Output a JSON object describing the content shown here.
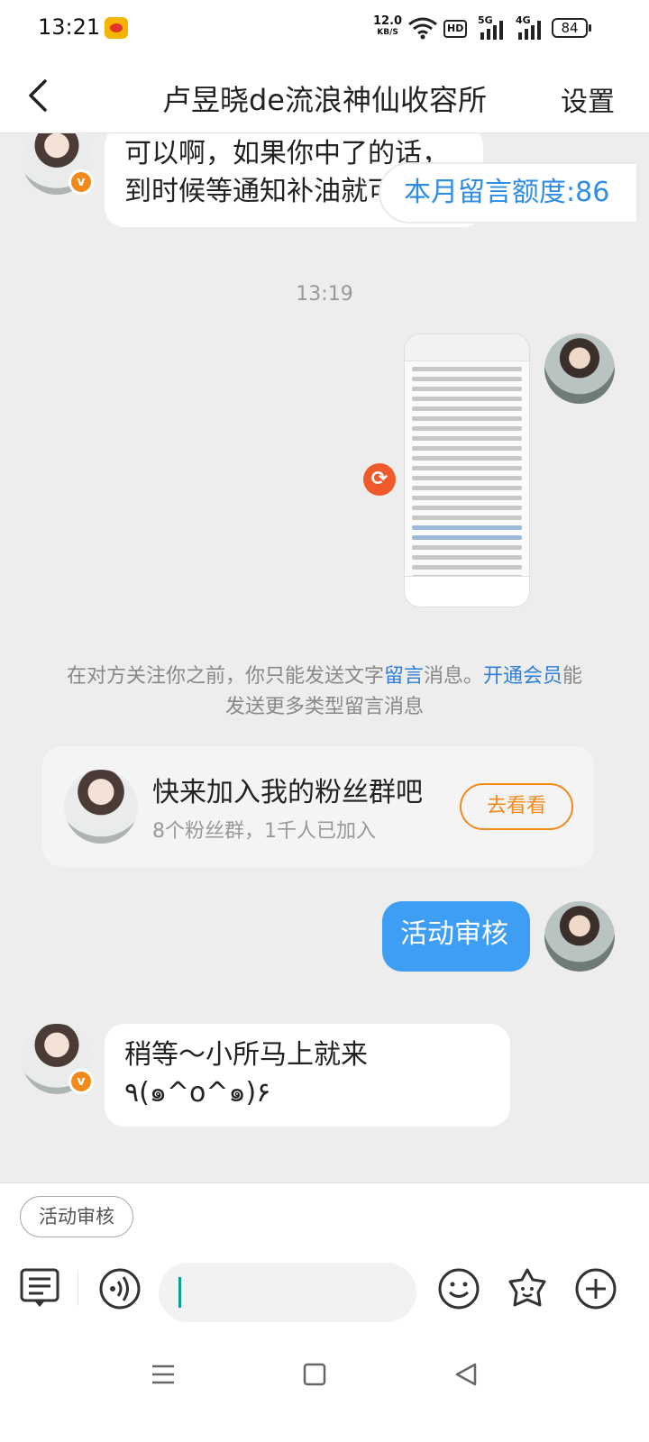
{
  "status_bar": {
    "time": "13:21",
    "net_speed": "12.0",
    "net_speed_unit": "KB/S",
    "hd_label": "HD",
    "network_1": "5G",
    "network_2": "4G",
    "battery": "84"
  },
  "header": {
    "title": "卢昱晓de流浪神仙收容所",
    "settings_label": "设置"
  },
  "quota": {
    "label": "本月留言额度:86"
  },
  "messages": {
    "msg1": {
      "text": "可以啊，如果你中了的话，到时候等通知补油就可"
    },
    "time_sep": "13:19",
    "msg3": {
      "text": "活动审核"
    },
    "msg4": {
      "text": "稍等～小所马上就来 ٩(๑^o^๑)۶"
    }
  },
  "notice": {
    "prefix": "在对方关注你之前，你只能发送文字",
    "link1": "留言",
    "middle": "消息。",
    "link2": "开通会员",
    "suffix": "能发送更多类型留言消息"
  },
  "fan_group": {
    "title": "快来加入我的粉丝群吧",
    "subtitle": "8个粉丝群，1千人已加入",
    "button": "去看看"
  },
  "composer": {
    "quick_reply": "活动审核"
  },
  "colors": {
    "accent_blue": "#3e9ef3",
    "link_blue": "#2f7fd6",
    "orange": "#f28a1a"
  }
}
